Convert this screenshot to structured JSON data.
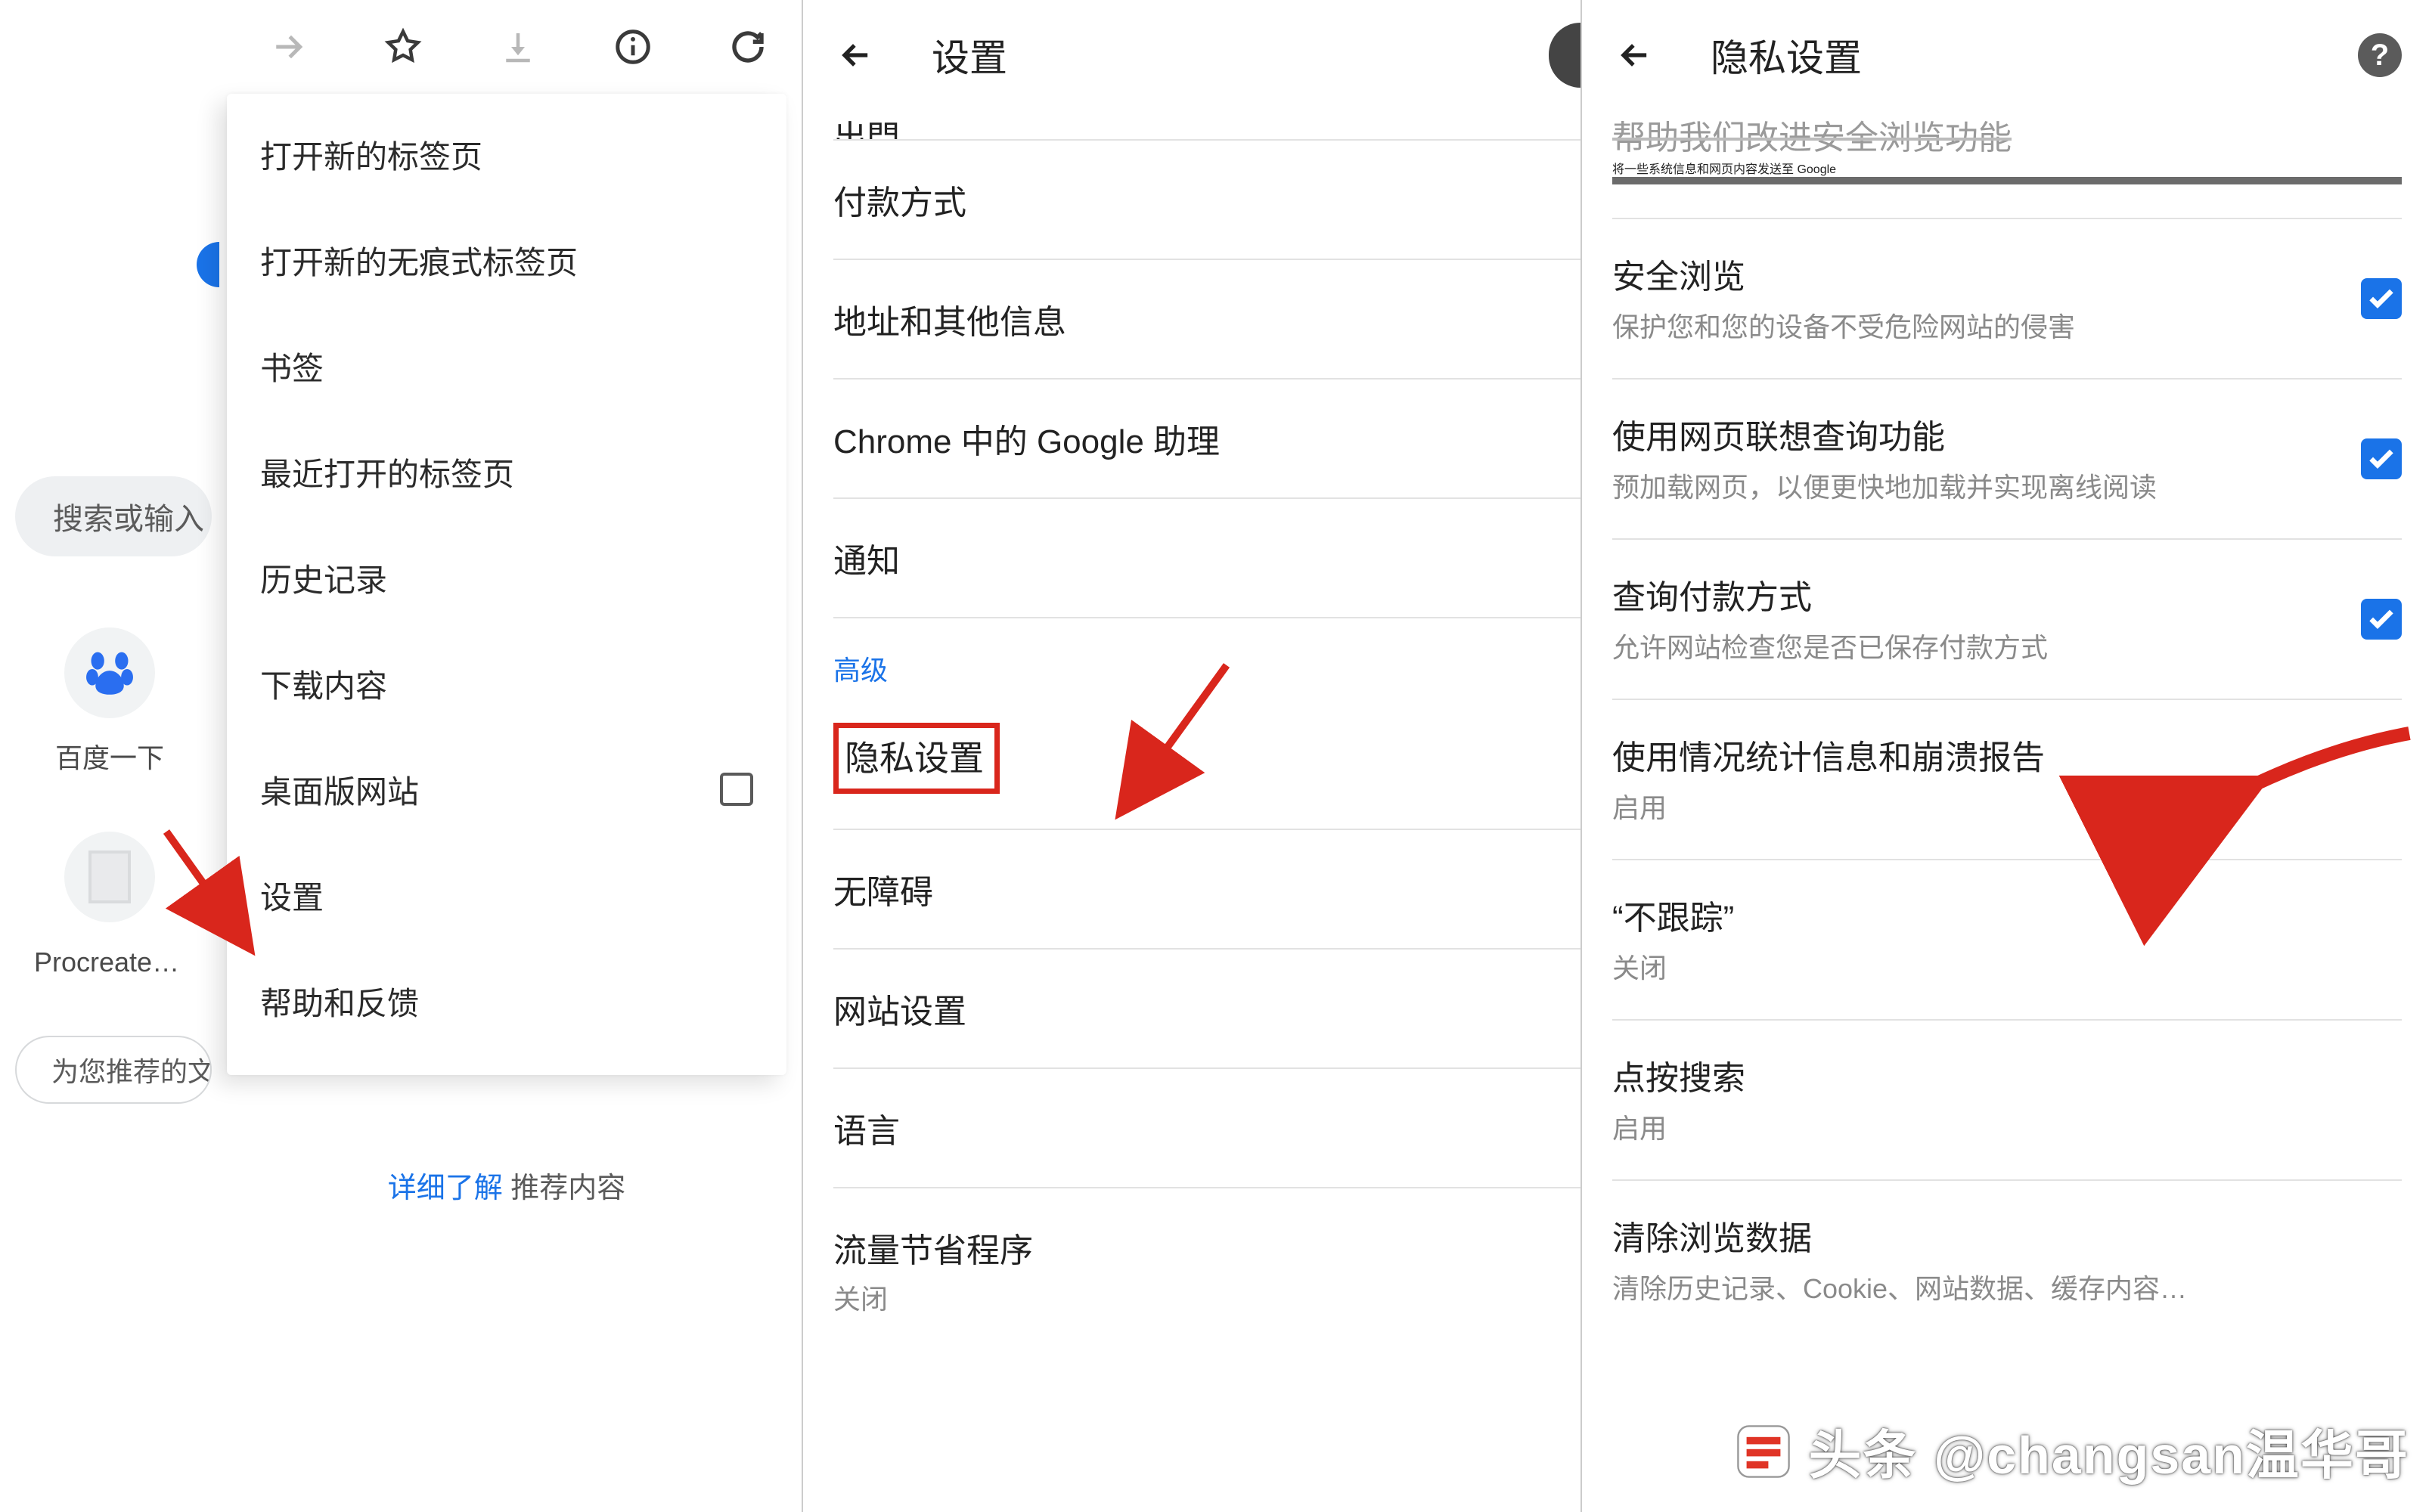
{
  "pane1": {
    "search_placeholder": "搜索或输入",
    "shortcuts": {
      "baidu": "百度一下",
      "file": "Procreate两…"
    },
    "recommend_prefix": "为您推荐的文",
    "menu": {
      "new_tab": "打开新的标签页",
      "new_incognito": "打开新的无痕式标签页",
      "bookmarks": "书签",
      "recent_tabs": "最近打开的标签页",
      "history": "历史记录",
      "downloads": "下载内容",
      "desktop_site": "桌面版网站",
      "settings": "设置",
      "help": "帮助和反馈"
    },
    "learn_more_link": "详细了解",
    "learn_more_rest": " 推荐内容"
  },
  "pane2": {
    "title": "设置",
    "cut_row": "出門",
    "rows": {
      "payment": "付款方式",
      "addresses": "地址和其他信息",
      "assistant": "Chrome 中的 Google 助理",
      "notifications": "通知"
    },
    "section_advanced": "高级",
    "privacy": "隐私设置",
    "rows2": {
      "accessibility": "无障碍",
      "site_settings": "网站设置",
      "language": "语言",
      "data_saver": "流量节省程序",
      "data_saver_sub": "关闭"
    }
  },
  "pane3": {
    "title": "隐私设置",
    "cut": {
      "title": "帮助我们改进安全浏览功能",
      "sub": "将一些系统信息和网页内容发送至 Google"
    },
    "safe_browsing": {
      "t": "安全浏览",
      "s": "保护您和您的设备不受危险网站的侵害"
    },
    "page_predict": {
      "t": "使用网页联想查询功能",
      "s": "预加载网页，以便更快地加载并实现离线阅读"
    },
    "check_payment": {
      "t": "查询付款方式",
      "s": "允许网站检查您是否已保存付款方式"
    },
    "usage_stats": {
      "t": "使用情况统计信息和崩溃报告",
      "s": "启用"
    },
    "dnt": {
      "t": "“不跟踪”",
      "s": "关闭"
    },
    "touch_search": {
      "t": "点按搜索",
      "s": "启用"
    },
    "clear_data": {
      "t": "清除浏览数据",
      "s": "清除历史记录、Cookie、网站数据、缓存内容…"
    }
  },
  "watermark": "头条 @changsan温华哥"
}
